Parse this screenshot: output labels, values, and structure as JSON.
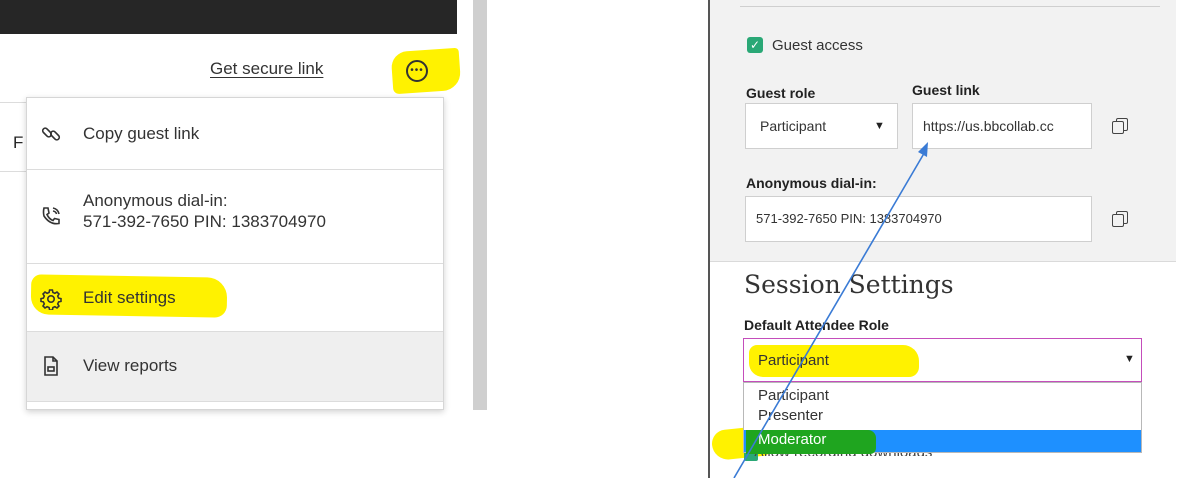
{
  "left": {
    "get_secure_link": "Get secure link",
    "more_icon": "ellipsis-circle-icon",
    "partial_letter": "F",
    "menu": {
      "items": [
        {
          "label": "Copy guest link",
          "icon": "link-icon"
        },
        {
          "label": "Anonymous dial-in:",
          "label2": "571-392-7650 PIN: 1383704970",
          "icon": "phone-icon"
        },
        {
          "label": "Edit settings",
          "icon": "gear-icon"
        },
        {
          "label": "View reports",
          "icon": "document-icon"
        }
      ]
    },
    "highlight_color": "#fff200"
  },
  "right": {
    "guest_access_label": "Guest access",
    "guest_access_checked": true,
    "guest_role_label": "Guest role",
    "guest_role_value": "Participant",
    "guest_link_label": "Guest link",
    "guest_link_value": "https://us.bbcollab.cc",
    "anon_dialin_label": "Anonymous dial-in:",
    "anon_dialin_value": "571-392-7650 PIN: 1383704970",
    "session_settings_title": "Session Settings",
    "default_attendee_role_label": "Default Attendee Role",
    "default_attendee_role_value": "Participant",
    "role_options": [
      "Participant",
      "Presenter",
      "Moderator"
    ],
    "selected_option": "Moderator",
    "partial_checkbox_label": "Allow recording downloads",
    "accent_check_color": "#2aa876",
    "selection_color": "#1e90ff",
    "annotation_arrow_color": "#3a7bd5"
  }
}
